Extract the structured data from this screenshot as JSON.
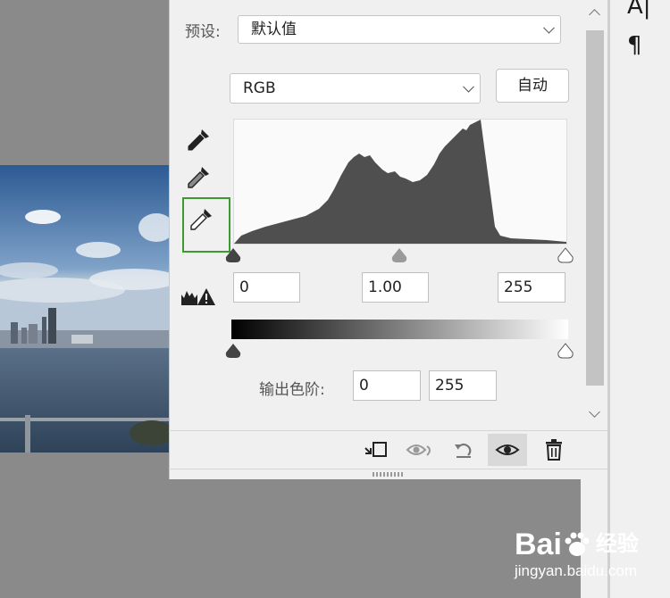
{
  "preset": {
    "label": "预设:",
    "value": "默认值"
  },
  "channel": {
    "value": "RGB"
  },
  "auto_button": "自动",
  "input_levels": {
    "shadow": "0",
    "gamma": "1.00",
    "highlight": "255"
  },
  "output_levels": {
    "label": "输出色阶:",
    "min": "0",
    "max": "255"
  },
  "right_toolbar": {
    "tool1": "A|",
    "tool2": "¶"
  },
  "footer_icons": [
    "clip-to-layer-icon",
    "view-previous-state-icon",
    "reset-icon",
    "visibility-eye-icon",
    "delete-trash-icon"
  ],
  "watermark": {
    "brand": "Bai",
    "brand_cn": "经验",
    "url": "jingyan.baidu.com"
  },
  "colors": {
    "panel_bg": "#f0f0f0",
    "canvas_bg": "#8a8a8a",
    "histogram": "#4f4f4f",
    "selected_eyedropper_border": "#3c9a30"
  }
}
